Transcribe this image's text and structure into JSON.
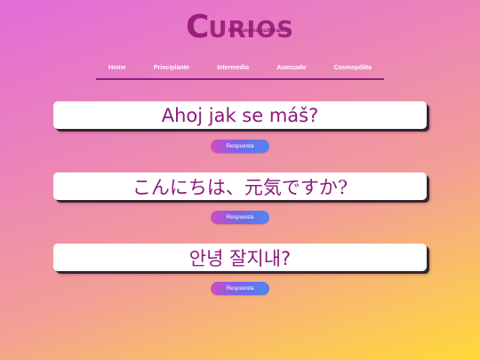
{
  "logo": {
    "initial": "C",
    "title_rest": "URIOS",
    "subtitle": "Minijuegos culturales"
  },
  "nav": {
    "items": [
      {
        "label": "Home"
      },
      {
        "label": "Principiante"
      },
      {
        "label": "Intermedio"
      },
      {
        "label": "Avanzado"
      },
      {
        "label": "Cosmopólita"
      }
    ]
  },
  "questions": [
    {
      "text": "Ahoj jak se máš?",
      "button_label": "Respuesta"
    },
    {
      "text": "こんにちは、元気ですか?",
      "button_label": "Respuesta"
    },
    {
      "text": "안녕 잘지내?",
      "button_label": "Respuesta"
    }
  ],
  "colors": {
    "accent": "#8c1a7c",
    "button_gradient_start": "#d24bc3",
    "button_gradient_end": "#4e86f3"
  }
}
